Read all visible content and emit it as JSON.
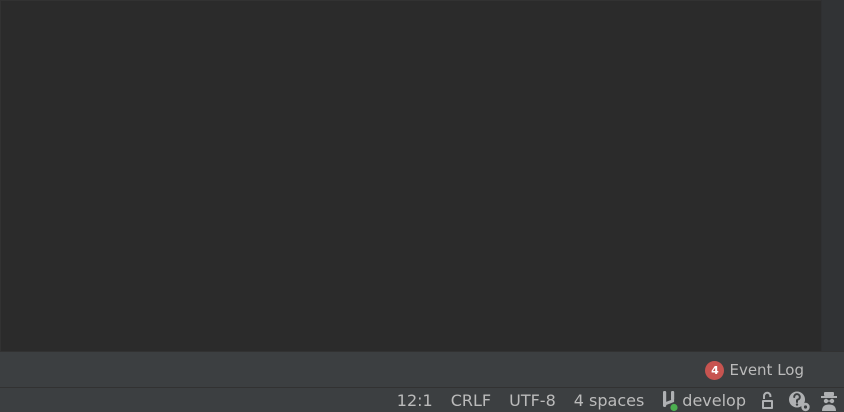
{
  "editor": {},
  "tool_strip": {
    "event_log": {
      "count": "4",
      "label": "Event Log"
    }
  },
  "status_bar": {
    "position": "12:1",
    "line_separator": "CRLF",
    "encoding": "UTF-8",
    "indent": "4 spaces",
    "vcs": {
      "branch": "develop",
      "icon": "git-branch-icon",
      "status_color": "#4caf50"
    },
    "icons": [
      "unlock-icon",
      "inspection-profile-icon",
      "hector-icon"
    ]
  },
  "colors": {
    "editor_bg": "#2b2b2b",
    "panel_bg": "#3c3f41",
    "text": "#bbbbbb",
    "badge": "#c75450"
  }
}
